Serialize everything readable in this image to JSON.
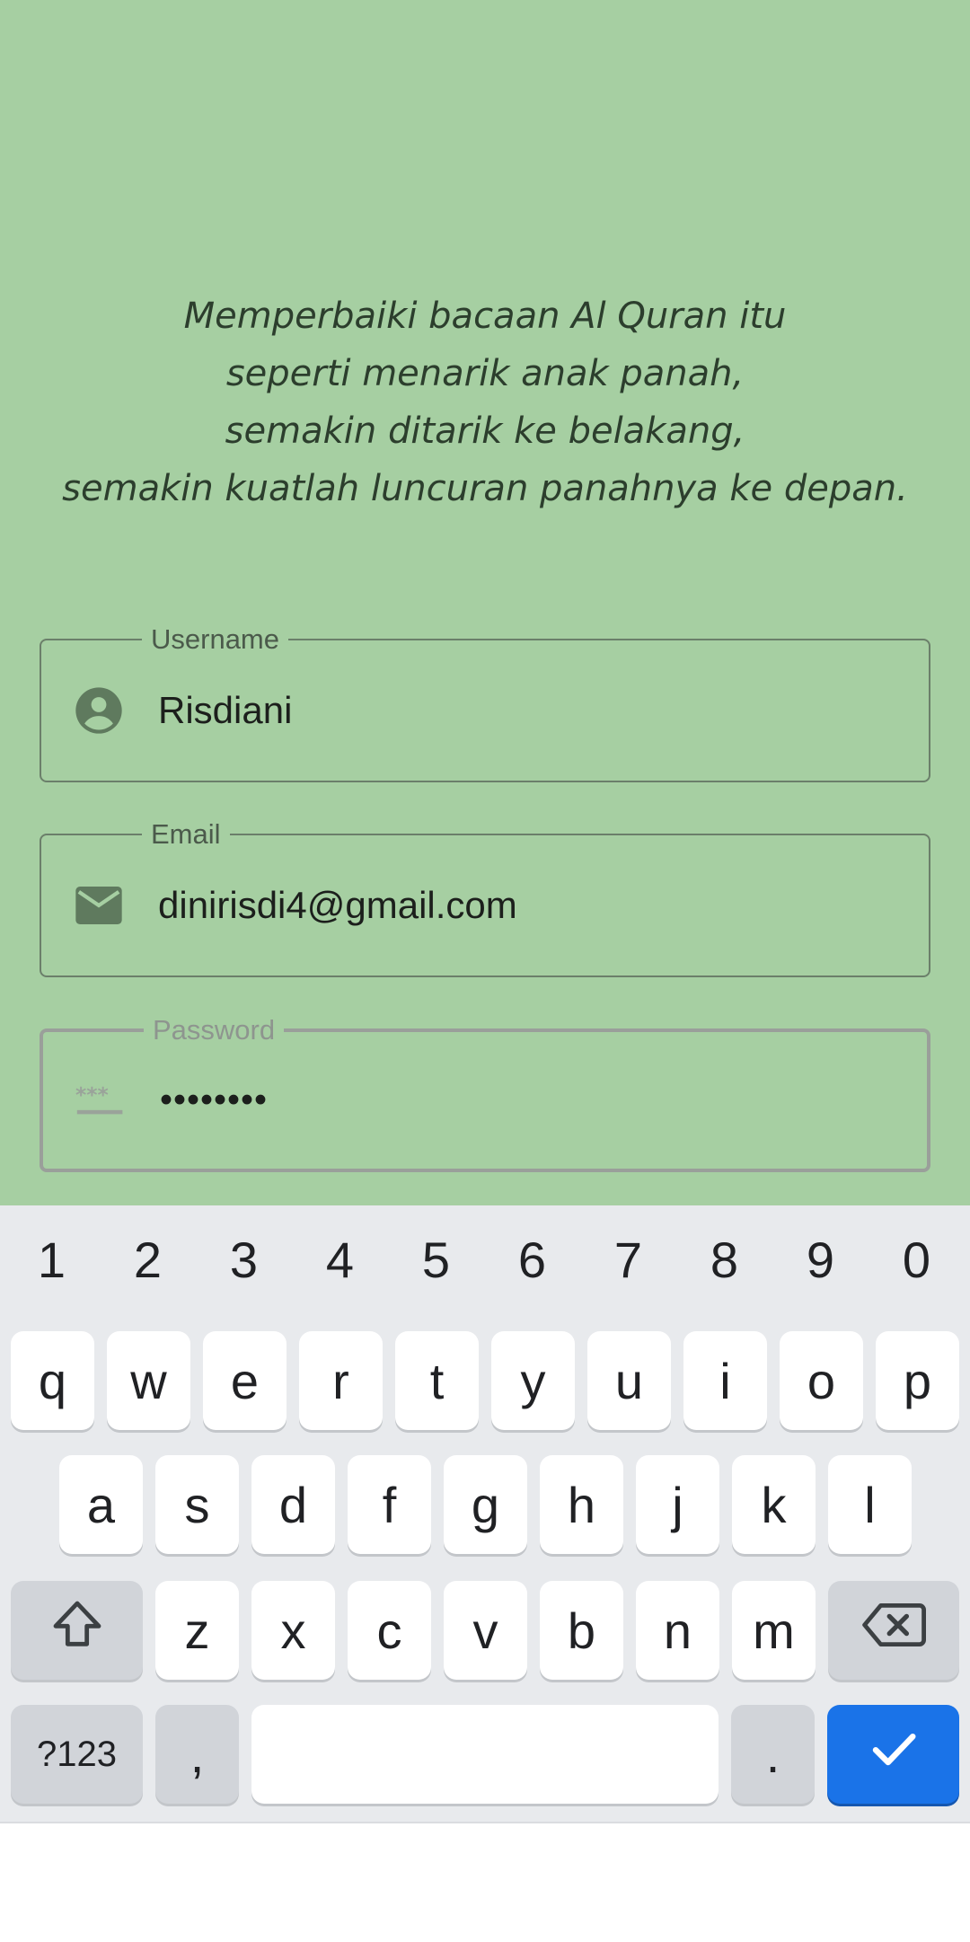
{
  "quote": {
    "lines": [
      "Memperbaiki bacaan Al Quran itu",
      "seperti menarik anak panah,",
      "semakin ditarik ke belakang,",
      "semakin kuatlah luncuran panahnya ke depan."
    ]
  },
  "form": {
    "username": {
      "label": "Username",
      "value": "Risdiani",
      "icon": "account-circle-icon"
    },
    "email": {
      "label": "Email",
      "value": "dinirisdi4@gmail.com",
      "icon": "mail-icon"
    },
    "password": {
      "label": "Password",
      "value": "••••••••",
      "icon": "password-icon"
    }
  },
  "keyboard": {
    "numbers": [
      "1",
      "2",
      "3",
      "4",
      "5",
      "6",
      "7",
      "8",
      "9",
      "0"
    ],
    "row1": [
      "q",
      "w",
      "e",
      "r",
      "t",
      "y",
      "u",
      "i",
      "o",
      "p"
    ],
    "row2": [
      "a",
      "s",
      "d",
      "f",
      "g",
      "h",
      "j",
      "k",
      "l"
    ],
    "row3": [
      "z",
      "x",
      "c",
      "v",
      "b",
      "n",
      "m"
    ],
    "symbols_label": "?123",
    "comma": ",",
    "period": ".",
    "shift_icon": "shift-icon",
    "backspace_icon": "backspace-icon",
    "enter_icon": "check-icon"
  },
  "colors": {
    "background": "#a6cfa2",
    "accent": "#1a73e8",
    "icon": "#5f7a5e"
  }
}
